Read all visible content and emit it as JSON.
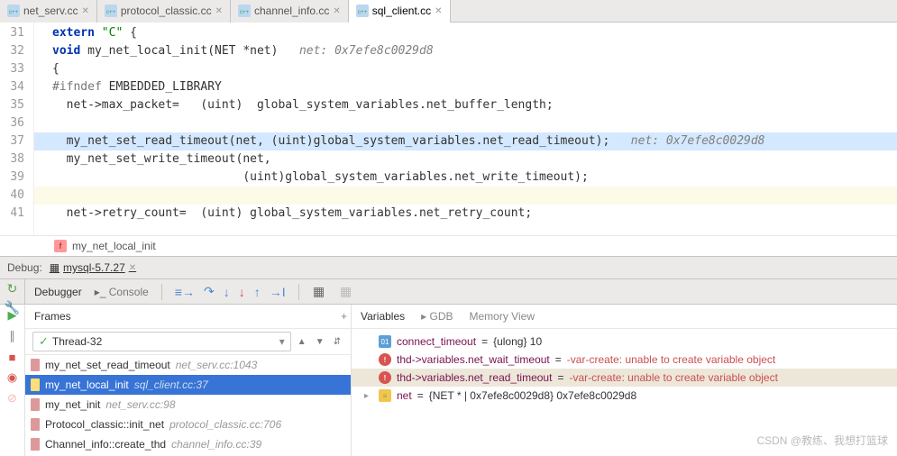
{
  "tabs": [
    {
      "label": "net_serv.cc",
      "active": false
    },
    {
      "label": "protocol_classic.cc",
      "active": false
    },
    {
      "label": "channel_info.cc",
      "active": false
    },
    {
      "label": "sql_client.cc",
      "active": true
    }
  ],
  "editor": {
    "lines": [
      {
        "n": "31",
        "pre": "",
        "html": "<span class='kw'>extern</span> <span class='txt'>\"C\"</span> {"
      },
      {
        "n": "32",
        "pre": "",
        "html": "<span class='kw'>void</span> my_net_local_init(NET *net)   <span class='cmt'>net: 0x7efe8c0029d8</span>"
      },
      {
        "n": "33",
        "pre": "",
        "html": "{"
      },
      {
        "n": "34",
        "pre": "",
        "html": "<span class='pre'>#ifndef</span> EMBEDDED_LIBRARY"
      },
      {
        "n": "35",
        "pre": "  ",
        "html": "net-&gt;max_packet=   (uint)  global_system_variables.net_buffer_length;"
      },
      {
        "n": "36",
        "pre": "",
        "html": ""
      },
      {
        "n": "37",
        "pre": "  ",
        "html": "my_net_set_read_timeout(net, (uint)global_system_variables.net_read_timeout);   <span class='cmt'>net: 0x7efe8c0029d8</span>",
        "hl": true
      },
      {
        "n": "38",
        "pre": "  ",
        "html": "my_net_set_write_timeout(net,"
      },
      {
        "n": "39",
        "pre": "                           ",
        "html": "(uint)global_system_variables.net_write_timeout);"
      },
      {
        "n": "40",
        "pre": "",
        "html": "",
        "cur": true
      },
      {
        "n": "41",
        "pre": "  ",
        "html": "net-&gt;retry_count=  (uint) global_system_variables.net_retry_count;"
      }
    ]
  },
  "crumb": {
    "fn": "my_net_local_init"
  },
  "debug": {
    "label": "Debug:",
    "session": "mysql-5.7.27",
    "subtabs": {
      "debugger": "Debugger",
      "console": "Console"
    },
    "frames_label": "Frames",
    "thread": "Thread-32",
    "frames": [
      {
        "name": "my_net_set_read_timeout",
        "loc": "net_serv.cc:1043",
        "sel": false
      },
      {
        "name": "my_net_local_init",
        "loc": "sql_client.cc:37",
        "sel": true
      },
      {
        "name": "my_net_init",
        "loc": "net_serv.cc:98",
        "sel": false
      },
      {
        "name": "Protocol_classic::init_net",
        "loc": "protocol_classic.cc:706",
        "sel": false
      },
      {
        "name": "Channel_info::create_thd",
        "loc": "channel_info.cc:39",
        "sel": false
      }
    ],
    "vars_tabs": {
      "vars": "Variables",
      "gdb": "GDB",
      "mem": "Memory View"
    },
    "vars": [
      {
        "icon": "01",
        "name": "connect_timeout",
        "eq": " = ",
        "val": "{ulong} 10"
      },
      {
        "icon": "err",
        "name": "thd->variables.net_wait_timeout",
        "eq": " = ",
        "err": "-var-create: unable to create variable object"
      },
      {
        "icon": "err",
        "name": "thd->variables.net_read_timeout",
        "eq": " = ",
        "err": "-var-create: unable to create variable object",
        "sel": true
      },
      {
        "icon": "obj",
        "chev": true,
        "name": "net",
        "eq": " = ",
        "val": "{NET * | 0x7efe8c0029d8} 0x7efe8c0029d8"
      }
    ]
  },
  "watermark": "CSDN @教练、我想打篮球"
}
